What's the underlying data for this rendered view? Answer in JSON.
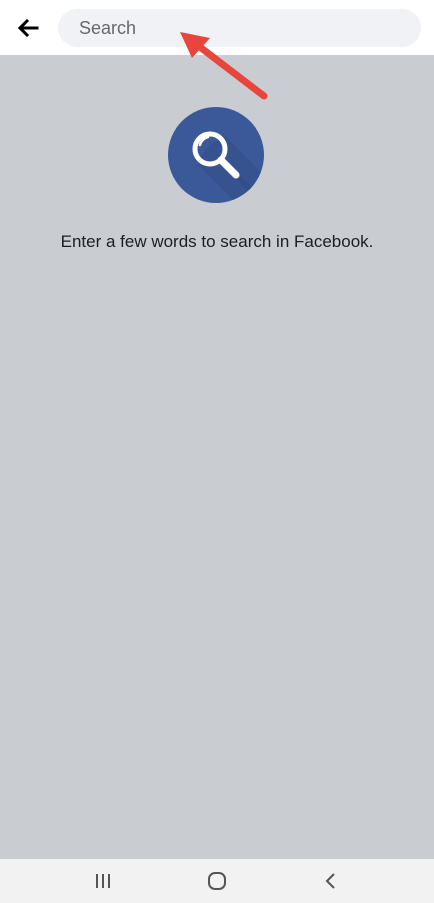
{
  "header": {
    "back_icon": "arrow-left-icon",
    "search": {
      "placeholder": "Search",
      "value": ""
    }
  },
  "main": {
    "illustration_icon": "magnifier-icon",
    "message": "Enter a few words to search in Facebook."
  },
  "annotation": {
    "type": "arrow",
    "color": "#e8453c",
    "points_to": "search-input"
  },
  "navbar": {
    "buttons": [
      "recent-apps-icon",
      "home-icon",
      "back-icon"
    ]
  },
  "colors": {
    "content_background": "#c9ccd1",
    "brand_blue": "#3b5998",
    "search_field_background": "#f0f2f5"
  }
}
